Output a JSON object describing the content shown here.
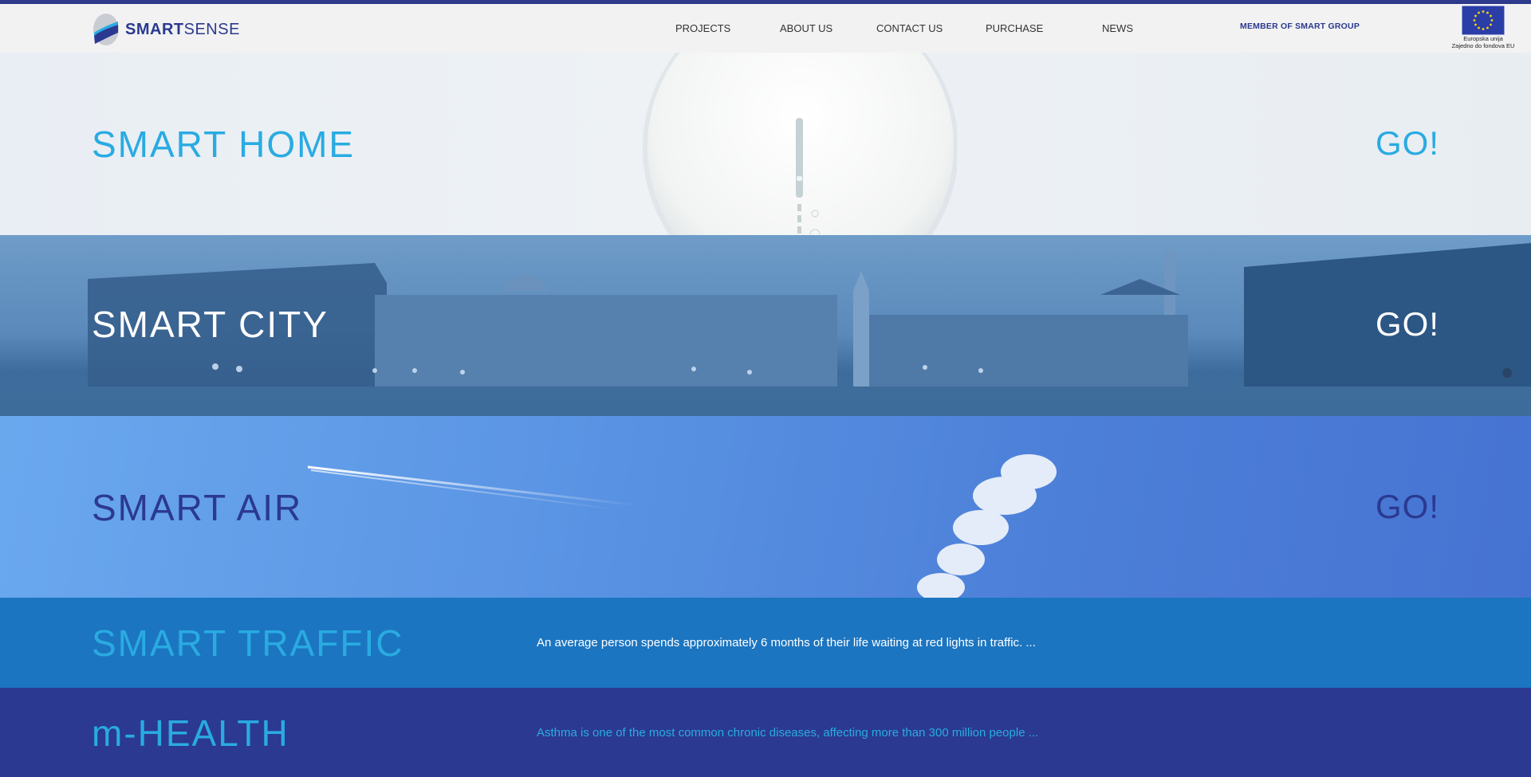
{
  "header": {
    "brand_bold": "SMART",
    "brand_light": "SENSE",
    "nav": [
      "PROJECTS",
      "ABOUT US",
      "CONTACT US",
      "PURCHASE",
      "NEWS"
    ],
    "member": "MEMBER OF SMART GROUP",
    "eu_line1": "Europska unija",
    "eu_line2": "Zajedno do fondova EU"
  },
  "sections": {
    "home": {
      "title": "SMART HOME",
      "go": "GO!"
    },
    "city": {
      "title": "SMART CITY",
      "go": "GO!"
    },
    "air": {
      "title": "SMART AIR",
      "go": "GO!"
    },
    "traffic": {
      "title": "SMART TRAFFIC",
      "desc": "An average person spends approximately 6 months of their life waiting at red lights in traffic. ..."
    },
    "health": {
      "title": "m-HEALTH",
      "desc": "Asthma is one of the most common chronic diseases, affecting more than 300 million people ..."
    }
  },
  "colors": {
    "brand_navy": "#2b3990",
    "brand_cyan": "#29abe2",
    "traffic_bg": "#1c75c0",
    "health_bg": "#2b3990"
  },
  "icons": {
    "logo": "smartsense-logo-icon",
    "eu_flag": "eu-flag-icon",
    "scroll_indicator": "scroll-indicator-icon"
  }
}
